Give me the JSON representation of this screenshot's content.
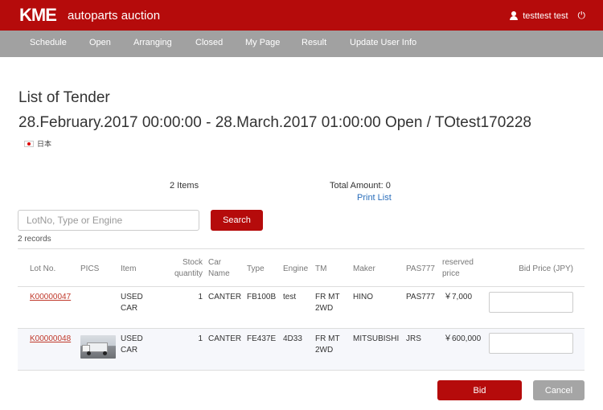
{
  "header": {
    "logo_mark": "KME",
    "logo_text": "autoparts auction",
    "user_name": "testtest test",
    "user_icon": "user-icon",
    "logout_icon": "power-icon",
    "brand_color": "#b50b0b"
  },
  "nav": {
    "items": [
      "Schedule",
      "Open",
      "Arranging",
      "Closed",
      "My Page",
      "Result",
      "Update User Info"
    ]
  },
  "page": {
    "title": "List of Tender",
    "subtitle": "28.February.2017 00:00:00 - 28.March.2017 01:00:00 Open / TOtest170228",
    "language": "日本",
    "language_icon": "japan-flag-icon"
  },
  "summary": {
    "items_count": "2 Items",
    "total_amount": "Total Amount: 0",
    "print_list": "Print List"
  },
  "search": {
    "placeholder": "LotNo, Type or Engine",
    "value": "",
    "button_label": "Search",
    "records": "2 records"
  },
  "table": {
    "headers": {
      "lot_no": "Lot No.",
      "pics": "PICS",
      "item": "Item",
      "stock_qty_1": "Stock",
      "stock_qty_2": "quantity",
      "car_name_1": "Car",
      "car_name_2": "Name",
      "type": "Type",
      "engine": "Engine",
      "tm": "TM",
      "maker": "Maker",
      "pas": "PAS777",
      "reserved_1": "reserved",
      "reserved_2": "price",
      "bid_price": "Bid Price (JPY)"
    },
    "rows": [
      {
        "lot_no": "K00000047",
        "has_pic": false,
        "item_1": "USED",
        "item_2": "CAR",
        "stock": "1",
        "car_name": "CANTER",
        "type": "FB100B",
        "engine": "test",
        "tm_1": "FR MT",
        "tm_2": "2WD",
        "maker": "HINO",
        "pas": "PAS777",
        "reserved_price": "￥7,000",
        "bid_value": ""
      },
      {
        "lot_no": "K00000048",
        "has_pic": true,
        "item_1": "USED",
        "item_2": "CAR",
        "stock": "1",
        "car_name": "CANTER",
        "type": "FE437E",
        "engine": "4D33",
        "tm_1": "FR MT",
        "tm_2": "2WD",
        "maker": "MITSUBISHI",
        "pas": "JRS",
        "reserved_price": "￥600,000",
        "bid_value": ""
      }
    ]
  },
  "actions": {
    "bid_label": "Bid",
    "cancel_label": "Cancel"
  }
}
